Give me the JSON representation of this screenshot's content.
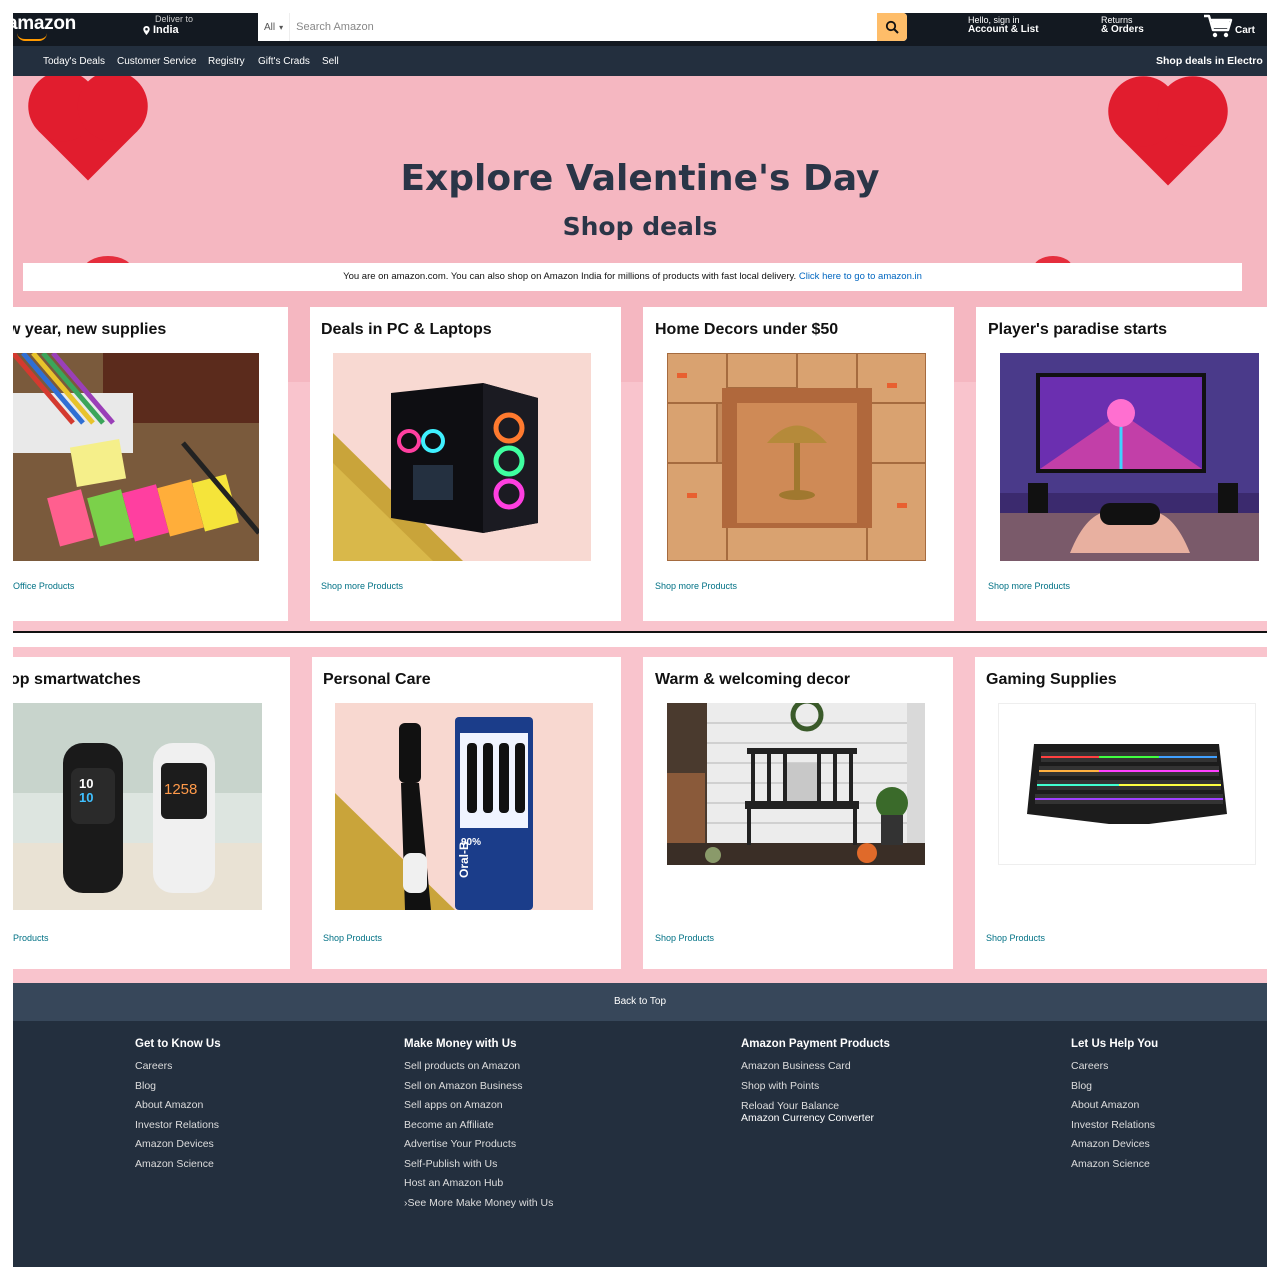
{
  "header": {
    "logo_text": "amazon",
    "deliver_small": "Deliver to",
    "deliver_location": "India",
    "search_category": "All",
    "search_placeholder": "Search Amazon",
    "account_small": "Hello, sign in",
    "account_bold": "Account & List",
    "orders_small": "Returns",
    "orders_bold": "& Orders",
    "cart_label": "Cart"
  },
  "subnav": {
    "items": [
      "Today's Deals",
      "Customer Service",
      "Registry",
      "Gift's Crads",
      "Sell"
    ],
    "promo": "Shop deals in Electro"
  },
  "hero": {
    "title": "Explore Valentine's Day",
    "subtitle": "Shop deals",
    "notice_text": "You are on amazon.com. You can also shop on Amazon India for millions of products with fast local delivery.",
    "notice_link": "Click here to go to amazon.in"
  },
  "cards_row1": [
    {
      "title": "w year, new supplies",
      "link": "Office Products",
      "image": "office-supplies-image"
    },
    {
      "title": "Deals in PC & Laptops",
      "link": "Shop more Products",
      "image": "gaming-pc-image"
    },
    {
      "title": "Home Decors under $50",
      "link": "Shop more Products",
      "image": "home-decor-lamp-image"
    },
    {
      "title": "Player's paradise starts",
      "link": "Shop more Products",
      "image": "gaming-setup-image"
    }
  ],
  "cards_row2": [
    {
      "title": "op smartwatches",
      "link": "Products",
      "image": "smartwatches-image"
    },
    {
      "title": "Personal Care",
      "link": "Shop Products",
      "image": "toothbrush-image"
    },
    {
      "title": "Warm & welcoming decor",
      "link": "Shop Products",
      "image": "porch-bench-image"
    },
    {
      "title": "Gaming Supplies",
      "link": "Shop Products",
      "image": "gaming-keyboard-image"
    }
  ],
  "watch_readouts": {
    "left_top": "10",
    "left_bottom": "10",
    "right": "1258"
  },
  "toothbrush_pack": {
    "badge": "90%",
    "brand": "Oral-B"
  },
  "footer": {
    "back_to_top": "Back to Top",
    "columns": [
      {
        "heading": "Get to Know Us",
        "links": [
          "Careers",
          "Blog",
          "About Amazon",
          "Investor Relations",
          "Amazon Devices",
          "Amazon Science"
        ]
      },
      {
        "heading": "Make Money with Us",
        "links": [
          "Sell products on Amazon",
          "Sell on Amazon Business",
          "Sell apps on Amazon",
          "Become an Affiliate",
          "Advertise Your Products",
          "Self-Publish with Us",
          "Host an Amazon Hub",
          "›See More Make Money with Us"
        ]
      },
      {
        "heading": "Amazon Payment Products",
        "links": [
          "Amazon Business Card",
          "Shop with Points",
          "Reload Your Balance",
          "Amazon Currency Converter"
        ]
      },
      {
        "heading": "Let Us Help You",
        "links": [
          "Careers",
          "Blog",
          "About Amazon",
          "Investor Relations",
          "Amazon Devices",
          "Amazon Science"
        ]
      }
    ]
  },
  "colors": {
    "nav_dark": "#131921",
    "subnav": "#232f3e",
    "accent_orange": "#febd69",
    "hero_pink": "#f5b7c1",
    "row_pink": "#f9c4cd",
    "link_teal": "#007185"
  }
}
